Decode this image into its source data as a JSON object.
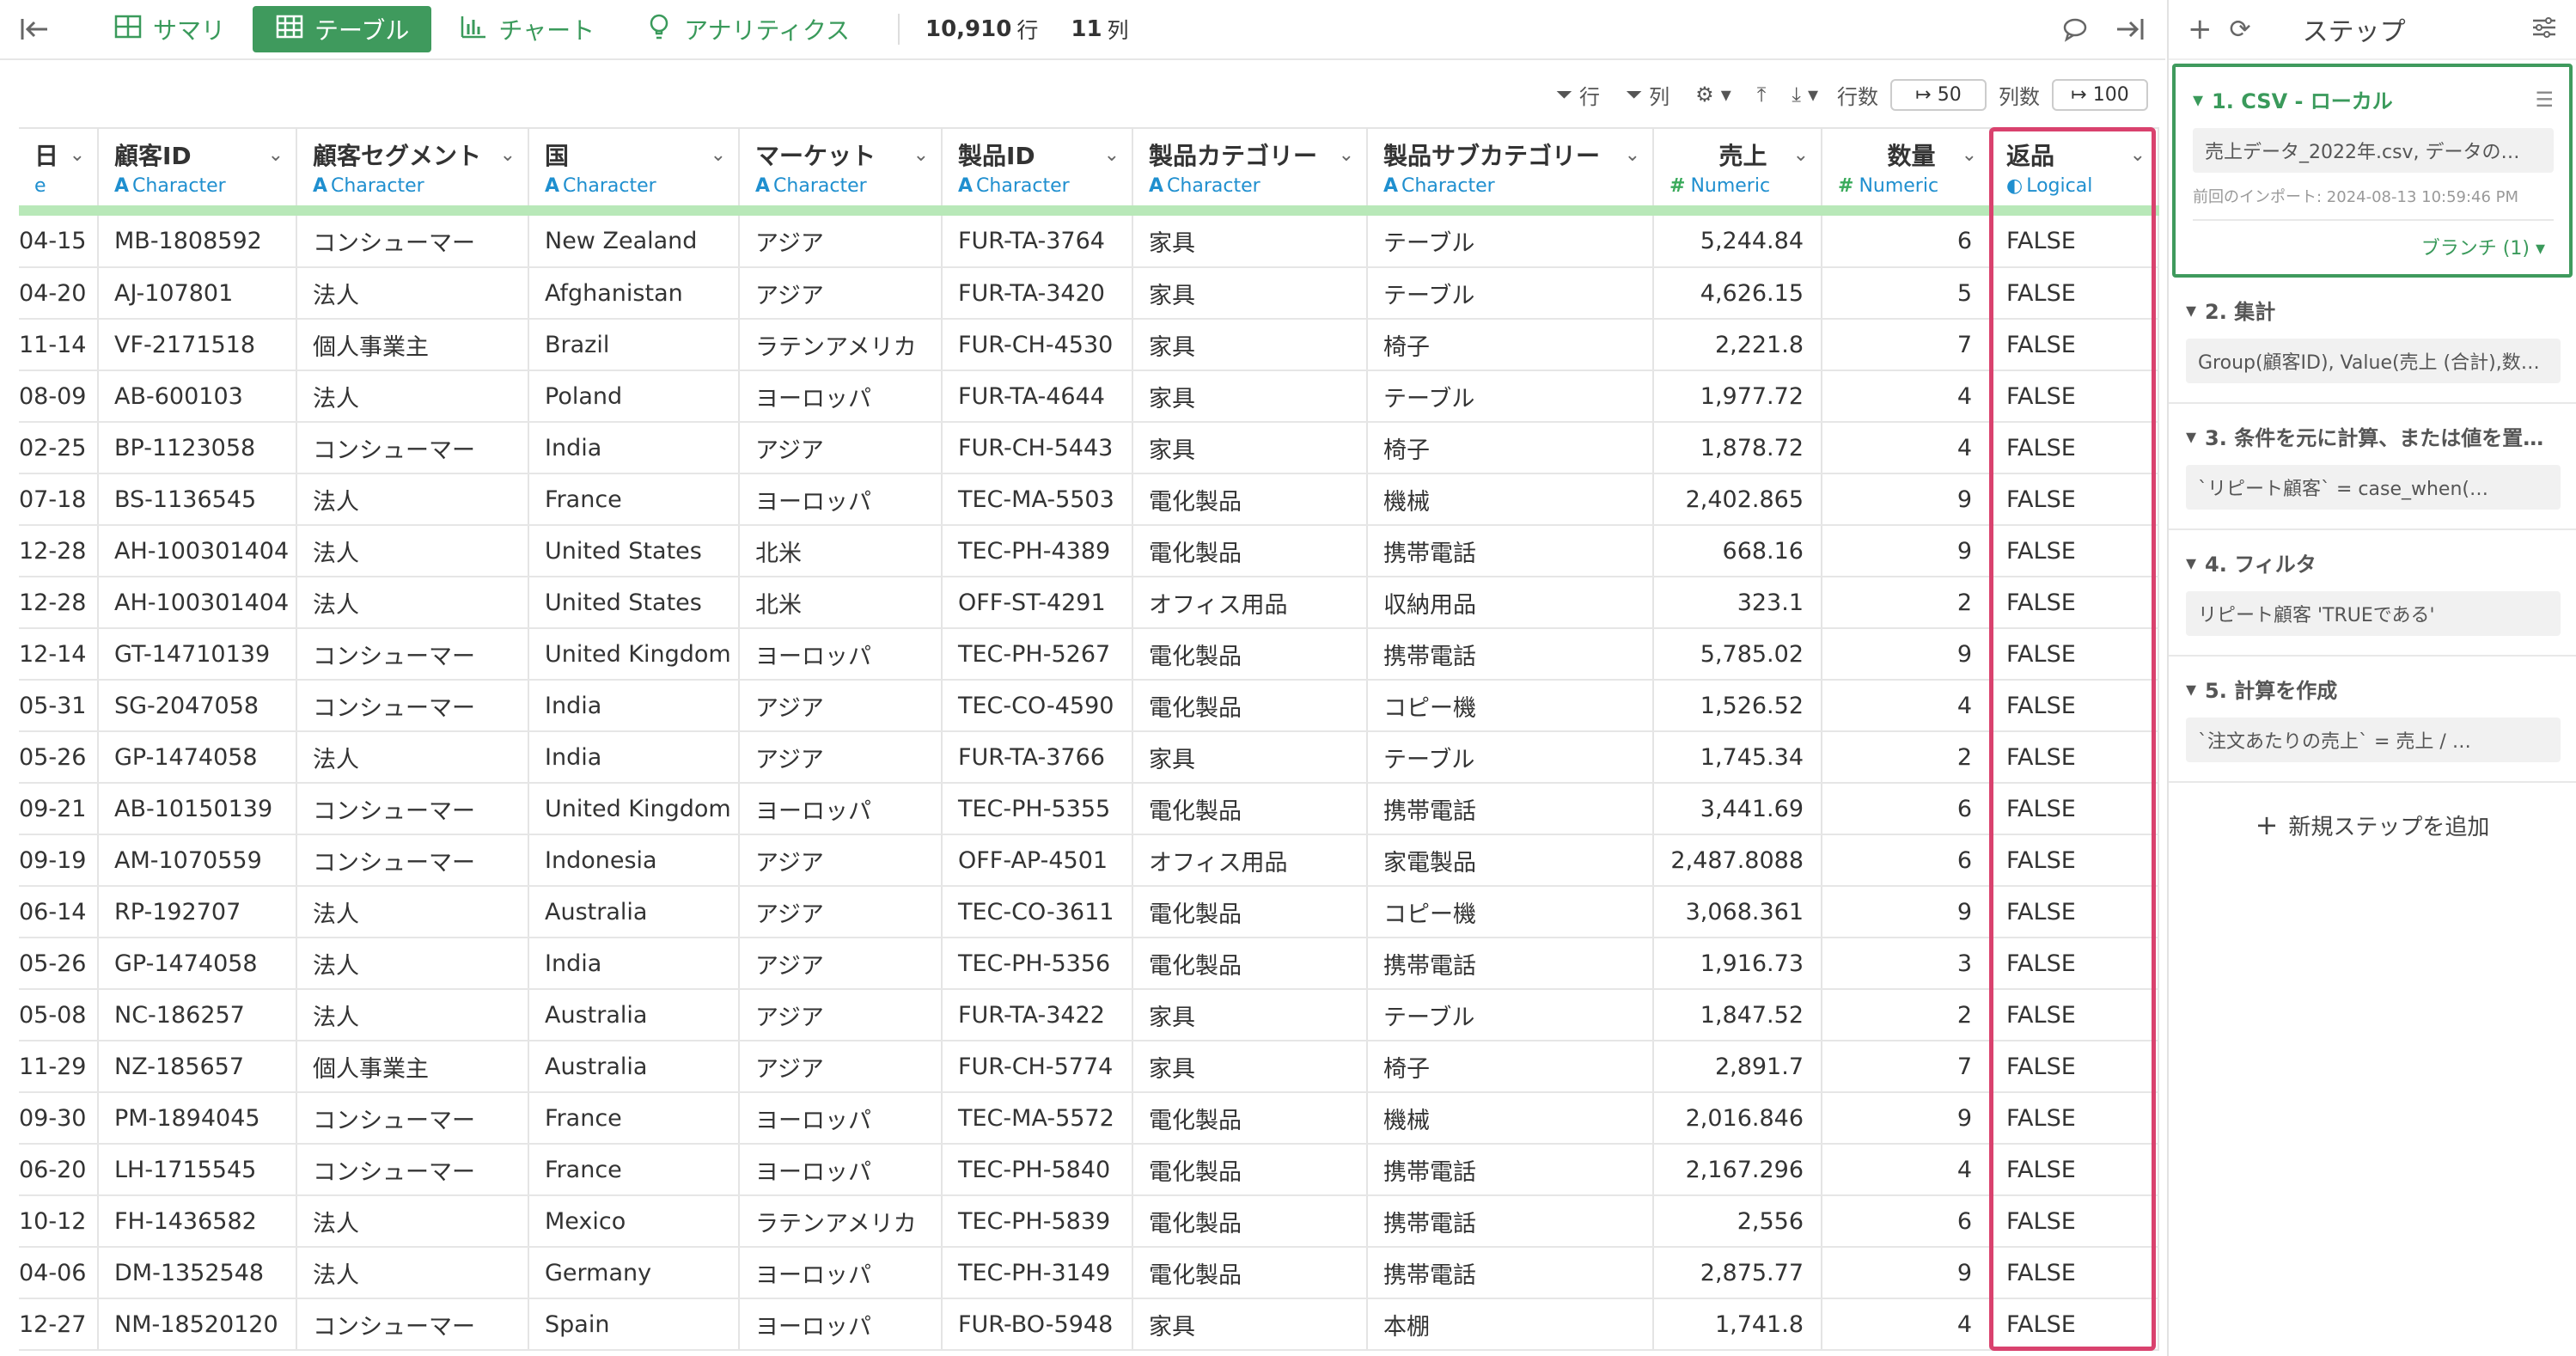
{
  "toolbar": {
    "tabs": [
      {
        "label": "サマリ",
        "icon": "summary-grid-icon"
      },
      {
        "label": "テーブル",
        "icon": "table-icon"
      },
      {
        "label": "チャート",
        "icon": "bar-chart-icon"
      },
      {
        "label": "アナリティクス",
        "icon": "lightbulb-icon"
      }
    ],
    "row_count": "10,910",
    "row_unit": "行",
    "col_count": "11",
    "col_unit": "列"
  },
  "subbar": {
    "row_filter": "行",
    "col_filter": "列",
    "rows_label": "行数",
    "rows_value": "50",
    "cols_label": "列数",
    "cols_value": "100"
  },
  "columns": [
    {
      "name": "日",
      "type": "e"
    },
    {
      "name": "顧客ID",
      "type": "Character"
    },
    {
      "name": "顧客セグメント",
      "type": "Character"
    },
    {
      "name": "国",
      "type": "Character"
    },
    {
      "name": "マーケット",
      "type": "Character"
    },
    {
      "name": "製品ID",
      "type": "Character"
    },
    {
      "name": "製品カテゴリー",
      "type": "Character"
    },
    {
      "name": "製品サブカテゴリー",
      "type": "Character"
    },
    {
      "name": "売上",
      "type": "Numeric"
    },
    {
      "name": "数量",
      "type": "Numeric"
    },
    {
      "name": "返品",
      "type": "Logical"
    }
  ],
  "rows": [
    [
      "04-15",
      "MB-1808592",
      "コンシューマー",
      "New Zealand",
      "アジア",
      "FUR-TA-3764",
      "家具",
      "テーブル",
      "5,244.84",
      "6",
      "FALSE"
    ],
    [
      "04-20",
      "AJ-107801",
      "法人",
      "Afghanistan",
      "アジア",
      "FUR-TA-3420",
      "家具",
      "テーブル",
      "4,626.15",
      "5",
      "FALSE"
    ],
    [
      "11-14",
      "VF-2171518",
      "個人事業主",
      "Brazil",
      "ラテンアメリカ",
      "FUR-CH-4530",
      "家具",
      "椅子",
      "2,221.8",
      "7",
      "FALSE"
    ],
    [
      "08-09",
      "AB-600103",
      "法人",
      "Poland",
      "ヨーロッパ",
      "FUR-TA-4644",
      "家具",
      "テーブル",
      "1,977.72",
      "4",
      "FALSE"
    ],
    [
      "02-25",
      "BP-1123058",
      "コンシューマー",
      "India",
      "アジア",
      "FUR-CH-5443",
      "家具",
      "椅子",
      "1,878.72",
      "4",
      "FALSE"
    ],
    [
      "07-18",
      "BS-1136545",
      "法人",
      "France",
      "ヨーロッパ",
      "TEC-MA-5503",
      "電化製品",
      "機械",
      "2,402.865",
      "9",
      "FALSE"
    ],
    [
      "12-28",
      "AH-100301404",
      "法人",
      "United States",
      "北米",
      "TEC-PH-4389",
      "電化製品",
      "携帯電話",
      "668.16",
      "9",
      "FALSE"
    ],
    [
      "12-28",
      "AH-100301404",
      "法人",
      "United States",
      "北米",
      "OFF-ST-4291",
      "オフィス用品",
      "収納用品",
      "323.1",
      "2",
      "FALSE"
    ],
    [
      "12-14",
      "GT-14710139",
      "コンシューマー",
      "United Kingdom",
      "ヨーロッパ",
      "TEC-PH-5267",
      "電化製品",
      "携帯電話",
      "5,785.02",
      "9",
      "FALSE"
    ],
    [
      "05-31",
      "SG-2047058",
      "コンシューマー",
      "India",
      "アジア",
      "TEC-CO-4590",
      "電化製品",
      "コピー機",
      "1,526.52",
      "4",
      "FALSE"
    ],
    [
      "05-26",
      "GP-1474058",
      "法人",
      "India",
      "アジア",
      "FUR-TA-3766",
      "家具",
      "テーブル",
      "1,745.34",
      "2",
      "FALSE"
    ],
    [
      "09-21",
      "AB-10150139",
      "コンシューマー",
      "United Kingdom",
      "ヨーロッパ",
      "TEC-PH-5355",
      "電化製品",
      "携帯電話",
      "3,441.69",
      "6",
      "FALSE"
    ],
    [
      "09-19",
      "AM-1070559",
      "コンシューマー",
      "Indonesia",
      "アジア",
      "OFF-AP-4501",
      "オフィス用品",
      "家電製品",
      "2,487.8088",
      "6",
      "FALSE"
    ],
    [
      "06-14",
      "RP-192707",
      "法人",
      "Australia",
      "アジア",
      "TEC-CO-3611",
      "電化製品",
      "コピー機",
      "3,068.361",
      "9",
      "FALSE"
    ],
    [
      "05-26",
      "GP-1474058",
      "法人",
      "India",
      "アジア",
      "TEC-PH-5356",
      "電化製品",
      "携帯電話",
      "1,916.73",
      "3",
      "FALSE"
    ],
    [
      "05-08",
      "NC-186257",
      "法人",
      "Australia",
      "アジア",
      "FUR-TA-3422",
      "家具",
      "テーブル",
      "1,847.52",
      "2",
      "FALSE"
    ],
    [
      "11-29",
      "NZ-185657",
      "個人事業主",
      "Australia",
      "アジア",
      "FUR-CH-5774",
      "家具",
      "椅子",
      "2,891.7",
      "7",
      "FALSE"
    ],
    [
      "09-30",
      "PM-1894045",
      "コンシューマー",
      "France",
      "ヨーロッパ",
      "TEC-MA-5572",
      "電化製品",
      "機械",
      "2,016.846",
      "9",
      "FALSE"
    ],
    [
      "06-20",
      "LH-1715545",
      "コンシューマー",
      "France",
      "ヨーロッパ",
      "TEC-PH-5840",
      "電化製品",
      "携帯電話",
      "2,167.296",
      "4",
      "FALSE"
    ],
    [
      "10-12",
      "FH-1436582",
      "法人",
      "Mexico",
      "ラテンアメリカ",
      "TEC-PH-5839",
      "電化製品",
      "携帯電話",
      "2,556",
      "6",
      "FALSE"
    ],
    [
      "04-06",
      "DM-1352548",
      "法人",
      "Germany",
      "ヨーロッパ",
      "TEC-PH-3149",
      "電化製品",
      "携帯電話",
      "2,875.77",
      "9",
      "FALSE"
    ],
    [
      "12-27",
      "NM-18520120",
      "コンシューマー",
      "Spain",
      "ヨーロッパ",
      "FUR-BO-5948",
      "家具",
      "本棚",
      "1,741.8",
      "4",
      "FALSE"
    ]
  ],
  "panel": {
    "title": "ステップ",
    "steps": [
      {
        "title": "1. CSV - ローカル",
        "body": "売上データ_2022年.csv, データの…",
        "meta": "前回のインポート: 2024-08-13 10:59:46 PM",
        "branch": "ブランチ (1)"
      },
      {
        "title": "2. 集計",
        "body": "Group(顧客ID), Value(売上 (合計),数…"
      },
      {
        "title": "3. 条件を元に計算、または値を置…",
        "body": "`リピート顧客` = case_when(…"
      },
      {
        "title": "4. フィルタ",
        "body": "リピート顧客 'TRUEである'"
      },
      {
        "title": "5. 計算を作成",
        "body": "`注文あたりの売上` = 売上 / …"
      }
    ],
    "add_step": "新規ステップを追加"
  },
  "colors": {
    "accent": "#3f9a5d",
    "highlight": "#d9426e",
    "type_blue": "#1f8fcf"
  }
}
